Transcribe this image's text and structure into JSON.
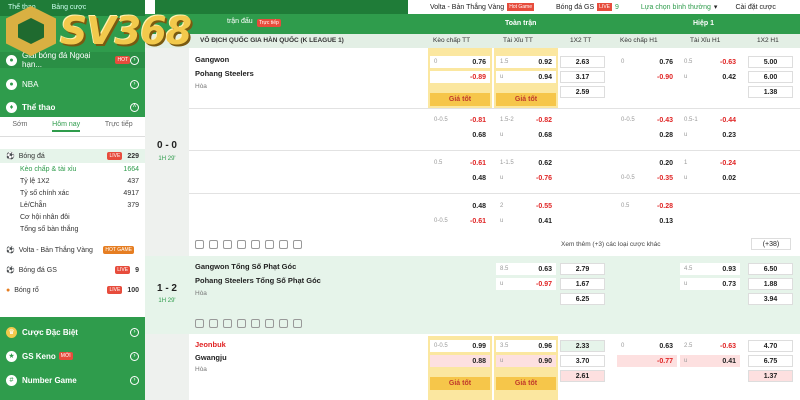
{
  "sidebar": {
    "top_tabs": [
      "Thể thao",
      "Bảng cược"
    ],
    "logo": "SV368",
    "items": [
      {
        "label": "Giải bóng đá Ngoại hạn...",
        "badge": "HOT"
      },
      {
        "label": "NBA"
      },
      {
        "label": "Thể thao"
      }
    ],
    "tabs": [
      "Sớm",
      "Hôm nay",
      "Trực tiếp"
    ],
    "sports": [
      {
        "label": "Bóng đá",
        "live": "LIVE",
        "count": "229"
      }
    ],
    "subs": [
      {
        "label": "Kèo chấp & tài xỉu",
        "count": "1664"
      },
      {
        "label": "Tỷ lệ 1X2",
        "count": "437"
      },
      {
        "label": "Tỷ số chính xác",
        "count": "4917"
      },
      {
        "label": "Lẻ/Chẵn",
        "count": "379"
      },
      {
        "label": "Cơ hội nhân đôi",
        "count": ""
      },
      {
        "label": "Tổng số bàn thắng",
        "count": ""
      }
    ],
    "extra": [
      {
        "label": "Volta - Bản Thắng Vàng",
        "badge": "HOT GAME",
        "count": ""
      },
      {
        "label": "Bóng đá GS",
        "live": "LIVE",
        "count": "9"
      },
      {
        "label": "Bóng rổ",
        "live": "LIVE",
        "count": "100"
      }
    ],
    "bottom": [
      {
        "label": "Cược Đặc Biệt"
      },
      {
        "label": "GS Keno",
        "badge": "MỚI"
      },
      {
        "label": "Number Game"
      }
    ]
  },
  "header": {
    "items": [
      "Volta - Bản Thắng Vàng",
      "Hot Game",
      "Bóng đá GS",
      "LIVE",
      "9",
      "Lựa chọn bình thường",
      "Cài đặt cược"
    ],
    "section_label": "trận đấu",
    "live_tag": "Trực tiếp",
    "league": "VÔ ĐỊCH QUỐC GIA HÀN QUỐC (K LEAGUE 1)",
    "full": "Toàn trận",
    "half": "Hiệp 1",
    "cols": [
      "Kèo chấp TT",
      "Tài Xỉu TT",
      "1X2 TT",
      "Kèo chấp H1",
      "Tài Xỉu H1",
      "1X2 H1"
    ]
  },
  "matches": {
    "m1": {
      "home": "Gangwon",
      "away": "Pohang Steelers",
      "draw": "Hòa",
      "score": "0 - 0",
      "minute": "1H 29'",
      "r1": {
        "hc_l1": "0",
        "hc_v1": "0.76",
        "hc_v2": "-0.89",
        "ou_l1": "1.5",
        "ou_v1": "0.92",
        "ou_l2": "u",
        "ou_v2": "0.94",
        "x1": "2.63",
        "x2": "3.17",
        "x3": "2.59",
        "h1_l": "0",
        "h1_v1": "0.76",
        "h1_v2": "-0.90",
        "hou_l1": "0.5",
        "hou_v1": "-0.63",
        "hou_l2": "u",
        "hou_v2": "0.42",
        "hx1": "5.00",
        "hx2": "6.00",
        "hx3": "1.38"
      },
      "gtot": "Giá tốt",
      "r2": {
        "hc_l": "0-0.5",
        "hc_v1": "-0.81",
        "hc_v2": "0.68",
        "ou_l": "1.5-2",
        "ou_v1": "-0.82",
        "ou_l2": "u",
        "ou_v2": "0.68",
        "h1_l": "0-0.5",
        "h1_v1": "-0.43",
        "h1_v2": "0.28",
        "hou_l": "0.5-1",
        "hou_v1": "-0.44",
        "hou_l2": "u",
        "hou_v2": "0.23"
      },
      "r3": {
        "hc_l": "0.5",
        "hc_v1": "-0.61",
        "hc_v2": "0.48",
        "ou_l": "1-1.5",
        "ou_v1": "0.62",
        "ou_l2": "u",
        "ou_v2": "-0.76",
        "h1_v1": "0.20",
        "h1_l2": "0-0.5",
        "h1_v2": "-0.35",
        "hou_l": "1",
        "hou_v1": "-0.24",
        "hou_l2": "u",
        "hou_v2": "0.02"
      },
      "r4": {
        "hc_v1": "0.48",
        "hc_l2": "0-0.5",
        "hc_v2": "-0.61",
        "ou_l": "2",
        "ou_v1": "-0.55",
        "ou_l2": "u",
        "ou_v2": "0.41",
        "h1_l": "0.5",
        "h1_v1": "-0.28",
        "h1_v2": "0.13"
      },
      "more": "Xem thêm (+3) các loại cược khác",
      "more2": "(+38)"
    },
    "m2": {
      "home": "Gangwon Tổng Số Phạt Góc",
      "away": "Pohang Steelers Tổng Số Phạt Góc",
      "draw": "Hòa",
      "score": "1 - 2",
      "minute": "1H 29'",
      "ou_l": "8.5",
      "ou_v1": "0.63",
      "ou_l2": "u",
      "ou_v2": "-0.97",
      "x1": "2.79",
      "x2": "1.67",
      "x3": "6.25",
      "hou_l": "4.5",
      "hou_v1": "0.93",
      "hou_l2": "u",
      "hou_v2": "0.73",
      "hx1": "6.50",
      "hx2": "1.88",
      "hx3": "3.94"
    },
    "m3": {
      "home": "Jeonbuk",
      "away": "Gwangju",
      "draw": "Hòa",
      "hc_l": "0-0.5",
      "hc_v1": "0.99",
      "hc_v2": "0.88",
      "ou_l": "3.5",
      "ou_v1": "0.96",
      "ou_l2": "u",
      "ou_v2": "0.90",
      "x1": "2.33",
      "x2": "3.70",
      "x3": "2.61",
      "h1_l": "0",
      "h1_v1": "0.63",
      "h1_v2": "-0.77",
      "hou_l": "2.5",
      "hou_v1": "-0.63",
      "hou_l2": "u",
      "hou_v2": "0.41",
      "hx1": "4.70",
      "hx2": "6.75",
      "hx3": "1.37"
    }
  }
}
